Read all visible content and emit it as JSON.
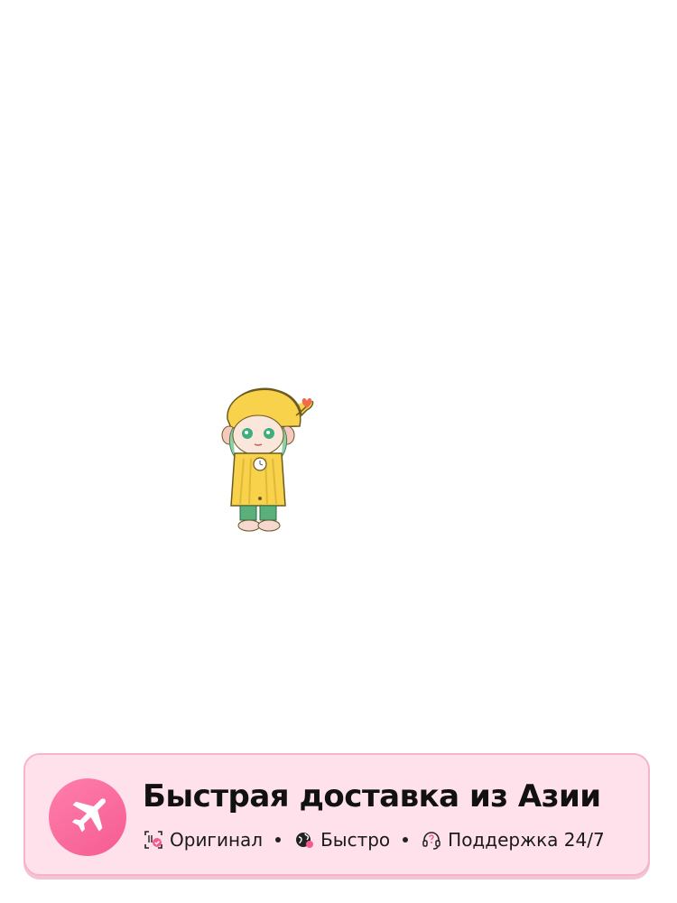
{
  "banner": {
    "title": "Быстрая доставка из Азии",
    "badge_icon": "airplane-icon",
    "accent_color": "#f55b92",
    "background_color": "#ffe1ec",
    "features": [
      {
        "label": "Оригинал",
        "icon": "authentic-scan-icon"
      },
      {
        "label": "Быстро",
        "icon": "globe-icon"
      },
      {
        "label": "Поддержка 24/7",
        "icon": "headset-icon"
      }
    ]
  },
  "product": {
    "illustration": "girl-figure-yellow-coat-illustration"
  }
}
